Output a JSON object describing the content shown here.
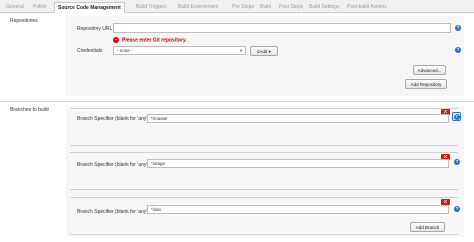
{
  "tabs": [
    {
      "label": "General"
    },
    {
      "label": "Polish"
    },
    {
      "label": "Source Code Management"
    },
    {
      "label": "Build Triggers"
    },
    {
      "label": "Build Environment"
    },
    {
      "label": "Pre Steps"
    },
    {
      "label": "Build"
    },
    {
      "label": "Post Steps"
    },
    {
      "label": "Build Settings"
    },
    {
      "label": "Post-build Actions"
    }
  ],
  "repositories": {
    "section_label": "Repositories",
    "url_label": "Repository URL",
    "url_value": "",
    "error_text": "Please enter Git repository.",
    "credentials_label": "Credentials",
    "credentials_value": "- none -",
    "add_label": "Add",
    "advanced_label": "Advanced...",
    "add_repository_label": "Add Repository"
  },
  "branches": {
    "section_label": "Branches to build",
    "specifier_label": "Branch Specifier (blank for 'any')",
    "items": [
      {
        "value": "*/master"
      },
      {
        "value": "*/stage"
      },
      {
        "value": "*/dev"
      }
    ],
    "delete_label": "X",
    "add_branch_label": "Add Branch"
  },
  "icons": {
    "help": "question-circle-icon",
    "error": "error-circle-icon",
    "delete": "delete-x-icon",
    "key": "key-icon"
  }
}
